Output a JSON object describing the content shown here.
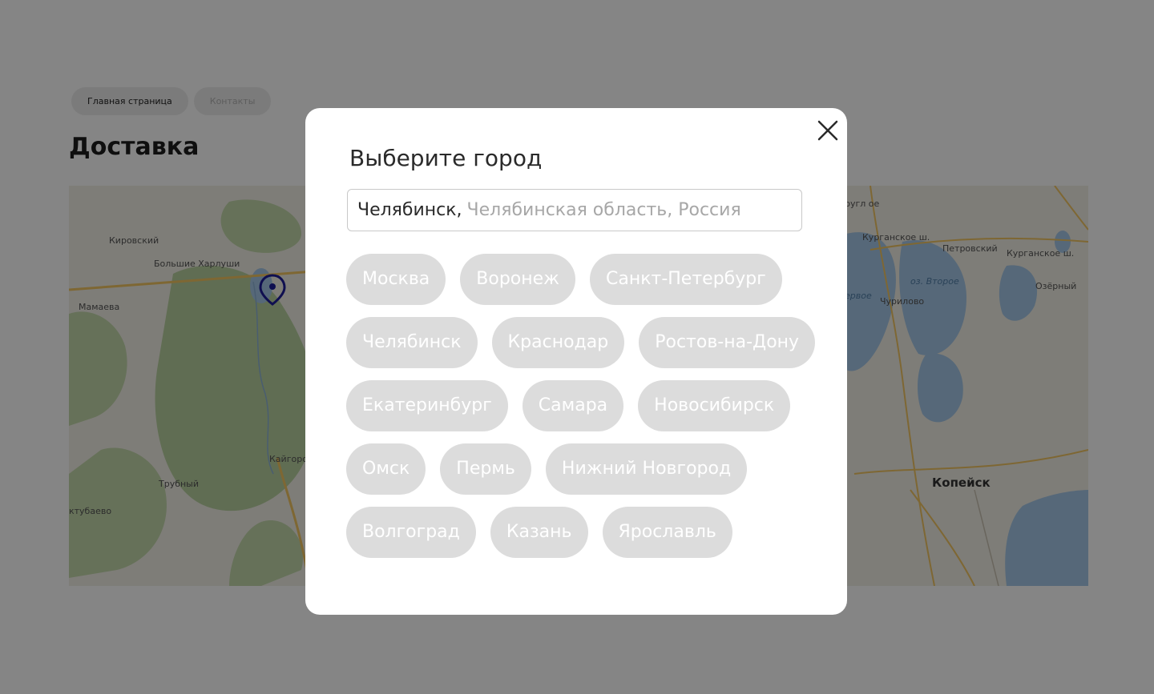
{
  "breadcrumb": {
    "items": [
      {
        "label": "Главная страница"
      },
      {
        "label": "Контакты"
      }
    ]
  },
  "page": {
    "title": "Доставка"
  },
  "map": {
    "labels": {
      "kirovsky": "Кировский",
      "bolshie_kharlushi": "Большие Харлуши",
      "mamaeva": "Мамаева",
      "kaigorodovo": "Кайгоро",
      "trubny": "Трубный",
      "aktubaevo": "ктубаево",
      "krugloe": "ругл ое",
      "kurganskoe_sh": "Курганское ш.",
      "petrovsky": "Петровский",
      "kurganskoe_sh2": "Курганское ш.",
      "ozero_vtoroe": "оз. Второе",
      "pervoe": "ервое",
      "churilovo": "Чурилово",
      "ozerny": "Озёрный",
      "kopeysk": "Копейск"
    },
    "marker_icon": "map-pin-icon",
    "colors": {
      "land": "#f1efe6",
      "forest": "#b9d1a0",
      "water": "#a6c8e8",
      "road": "#f2c563",
      "marker": "#1e1e9a"
    }
  },
  "modal": {
    "title": "Выберите город",
    "search": {
      "city": "Челябинск,",
      "region": "Челябинская область, Россия"
    },
    "close_icon": "close-icon",
    "cities": [
      [
        "Москва",
        "Воронеж",
        "Санкт-Петербург"
      ],
      [
        "Челябинск",
        "Краснодар",
        "Ростов-на-Дону"
      ],
      [
        "Екатеринбург",
        "Самара",
        "Новосибирск"
      ],
      [
        "Омск",
        "Пермь",
        "Нижний Новгород"
      ],
      [
        "Волгоград",
        "Казань",
        "Ярославль"
      ]
    ]
  }
}
